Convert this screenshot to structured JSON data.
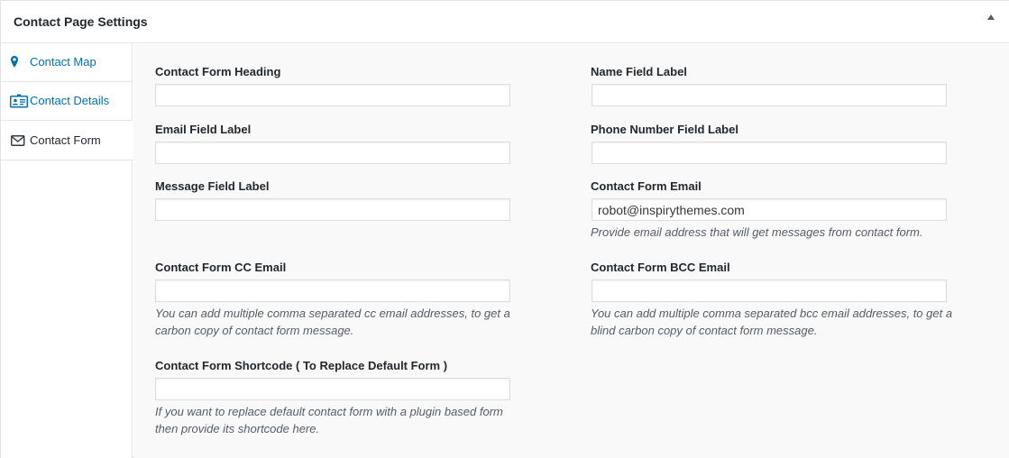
{
  "panel": {
    "title": "Contact Page Settings"
  },
  "sidebar": {
    "items": [
      {
        "label": "Contact Map",
        "icon": "map-pin-icon"
      },
      {
        "label": "Contact Details",
        "icon": "id-card-icon"
      },
      {
        "label": "Contact Form",
        "icon": "envelope-icon",
        "active": true
      }
    ]
  },
  "form": {
    "contact_form_heading": {
      "label": "Contact Form Heading",
      "value": ""
    },
    "name_field_label": {
      "label": "Name Field Label",
      "value": ""
    },
    "email_field_label": {
      "label": "Email Field Label",
      "value": ""
    },
    "phone_field_label": {
      "label": "Phone Number Field Label",
      "value": ""
    },
    "message_field_label": {
      "label": "Message Field Label",
      "value": ""
    },
    "contact_form_email": {
      "label": "Contact Form Email",
      "value": "robot@inspirythemes.com",
      "description": "Provide email address that will get messages from contact form."
    },
    "cc_email": {
      "label": "Contact Form CC Email",
      "value": "",
      "description_line1": "You can add multiple comma separated cc email addresses, to get a",
      "description_line2": "carbon copy of contact form message."
    },
    "bcc_email": {
      "label": "Contact Form BCC Email",
      "value": "",
      "description_line1": "You can add multiple comma separated bcc email addresses, to get a",
      "description_line2": "blind carbon copy of contact form message."
    },
    "shortcode": {
      "label": "Contact Form Shortcode ( To Replace Default Form )",
      "value": "",
      "description_line1": "If you want to replace default contact form with a plugin based form",
      "description_line2": "then provide its shortcode here."
    }
  }
}
